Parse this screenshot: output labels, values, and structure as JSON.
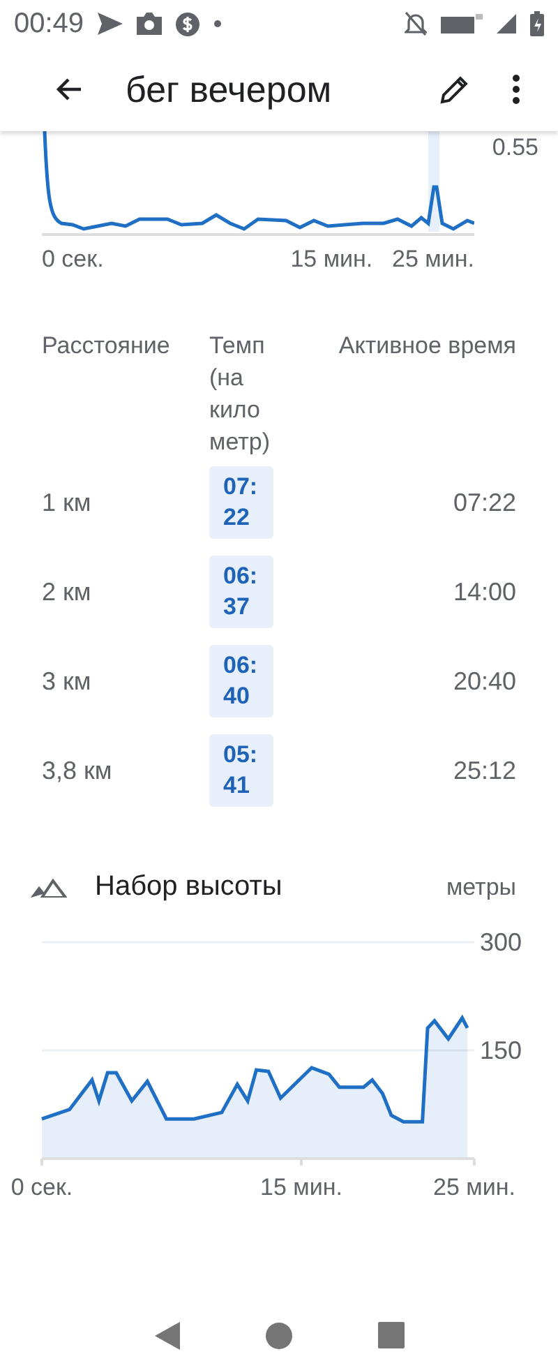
{
  "status_bar": {
    "time": "00:49"
  },
  "header": {
    "title": "бег вечером"
  },
  "pace_chart": {
    "y_label": "0.55",
    "x_labels": [
      "0 сек.",
      "15 мин.",
      "25 мин."
    ]
  },
  "splits": {
    "columns": [
      "Расстояние",
      "Темп (на кило метр)",
      "Активное время"
    ],
    "rows": [
      {
        "distance": "1 км",
        "pace": "07:22",
        "time": "07:22"
      },
      {
        "distance": "2 км",
        "pace": "06:37",
        "time": "14:00"
      },
      {
        "distance": "3 км",
        "pace": "06:40",
        "time": "20:40"
      },
      {
        "distance": "3,8 км",
        "pace": "05:41",
        "time": "25:12"
      }
    ]
  },
  "elevation": {
    "title": "Набор высоты",
    "unit": "метры",
    "chart_data": {
      "type": "area",
      "xlim": [
        0,
        25
      ],
      "ylim": [
        0,
        300
      ],
      "yticks": [
        150,
        300
      ],
      "xticks": [
        {
          "value": 0,
          "label": "0 сек."
        },
        {
          "value": 15,
          "label": "15 мин."
        },
        {
          "value": 25,
          "label": "25 мин."
        }
      ],
      "x": [
        0,
        1.6,
        2.9,
        3.3,
        3.8,
        4.3,
        5.2,
        6.1,
        7.2,
        8.8,
        10.4,
        11.3,
        11.9,
        12.4,
        13.1,
        13.8,
        15.6,
        16.6,
        17.2,
        18.6,
        19.1,
        19.7,
        20.2,
        20.9,
        22.0,
        22.3,
        22.7,
        23.5,
        24.3,
        24.6
      ],
      "series": [
        {
          "color": "#1f6fc5",
          "values": [
            55,
            68,
            109,
            80,
            119,
            119,
            80,
            107,
            55,
            55,
            64,
            103,
            80,
            123,
            121,
            84,
            126,
            117,
            99,
            99,
            109,
            90,
            60,
            51,
            51,
            181,
            191,
            166,
            195,
            181
          ]
        }
      ]
    }
  }
}
